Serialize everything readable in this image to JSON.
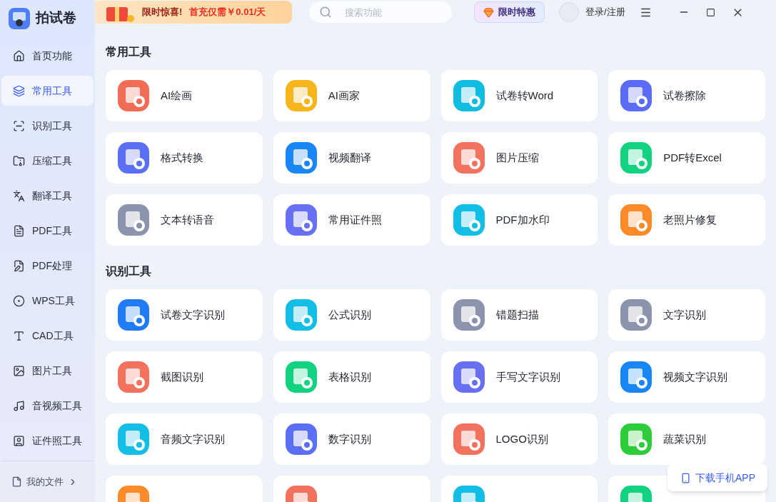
{
  "app": {
    "name": "拍试卷"
  },
  "promo": {
    "headline": "限时惊喜!",
    "offer": "首充仅需￥0.01/天"
  },
  "search": {
    "placeholder": "搜索功能"
  },
  "deal_button": "限时特惠",
  "login": "登录/注册",
  "sidebar": {
    "items": [
      {
        "label": "首页功能",
        "selected": false
      },
      {
        "label": "常用工具",
        "selected": true
      },
      {
        "label": "识别工具",
        "selected": false
      },
      {
        "label": "压缩工具",
        "selected": false
      },
      {
        "label": "翻译工具",
        "selected": false
      },
      {
        "label": "PDF工具",
        "selected": false
      },
      {
        "label": "PDF处理",
        "selected": false
      },
      {
        "label": "WPS工具",
        "selected": false
      },
      {
        "label": "CAD工具",
        "selected": false
      },
      {
        "label": "图片工具",
        "selected": false
      },
      {
        "label": "音视频工具",
        "selected": false
      },
      {
        "label": "证件照工具",
        "selected": false
      }
    ],
    "footer": "我的文件"
  },
  "sections": [
    {
      "title": "常用工具",
      "tools": [
        {
          "label": "AI绘画",
          "color": "#f26b55"
        },
        {
          "label": "AI画家",
          "color": "#f7b51c"
        },
        {
          "label": "试卷转Word",
          "color": "#10bde0"
        },
        {
          "label": "试卷擦除",
          "color": "#5a6cf5"
        },
        {
          "label": "格式转换",
          "color": "#5b6ff6"
        },
        {
          "label": "视频翻译",
          "color": "#1a86f5"
        },
        {
          "label": "图片压缩",
          "color": "#f3725e"
        },
        {
          "label": "PDF转Excel",
          "color": "#12d17f"
        },
        {
          "label": "文本转语音",
          "color": "#8b93ad"
        },
        {
          "label": "常用证件照",
          "color": "#6770f2"
        },
        {
          "label": "PDF加水印",
          "color": "#12bde6"
        },
        {
          "label": "老照片修复",
          "color": "#fb8a2a"
        }
      ]
    },
    {
      "title": "识别工具",
      "tools": [
        {
          "label": "试卷文字识别",
          "color": "#1f7cf5"
        },
        {
          "label": "公式识别",
          "color": "#12bde6"
        },
        {
          "label": "错题扫描",
          "color": "#8b93ad"
        },
        {
          "label": "文字识别",
          "color": "#8b93ad"
        },
        {
          "label": "截图识别",
          "color": "#f3725e"
        },
        {
          "label": "表格识别",
          "color": "#12d17f"
        },
        {
          "label": "手写文字识别",
          "color": "#6770f2"
        },
        {
          "label": "视频文字识别",
          "color": "#1a86f5"
        },
        {
          "label": "音频文字识别",
          "color": "#12bde6"
        },
        {
          "label": "数字识别",
          "color": "#5b6ff6"
        },
        {
          "label": "LOGO识别",
          "color": "#f3725e"
        },
        {
          "label": "蔬菜识别",
          "color": "#2ecc3a"
        },
        {
          "color": "#fb8a2a"
        },
        {
          "color": "#f3725e"
        },
        {
          "color": "#12bde6"
        },
        {
          "color": "#12d17f"
        }
      ]
    }
  ],
  "download_button": "下载手机APP"
}
